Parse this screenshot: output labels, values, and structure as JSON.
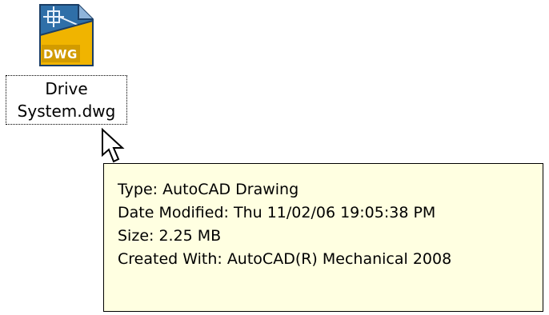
{
  "file": {
    "icon": "dwg-file-icon",
    "icon_badge": "DWG",
    "name_line1": "Drive",
    "name_line2": "System.dwg"
  },
  "cursor": {
    "icon": "arrow-cursor-icon"
  },
  "tooltip": {
    "type": "Type: AutoCAD Drawing",
    "date_modified": "Date Modified: Thu  11/02/06 19:05:38 PM",
    "size": "Size: 2.25 MB",
    "created_with": "Created With: AutoCAD(R) Mechanical 2008"
  },
  "colors": {
    "tooltip_background": "#ffffe1",
    "icon_badge": "#f0b400",
    "icon_body": "#2f6fa8"
  }
}
